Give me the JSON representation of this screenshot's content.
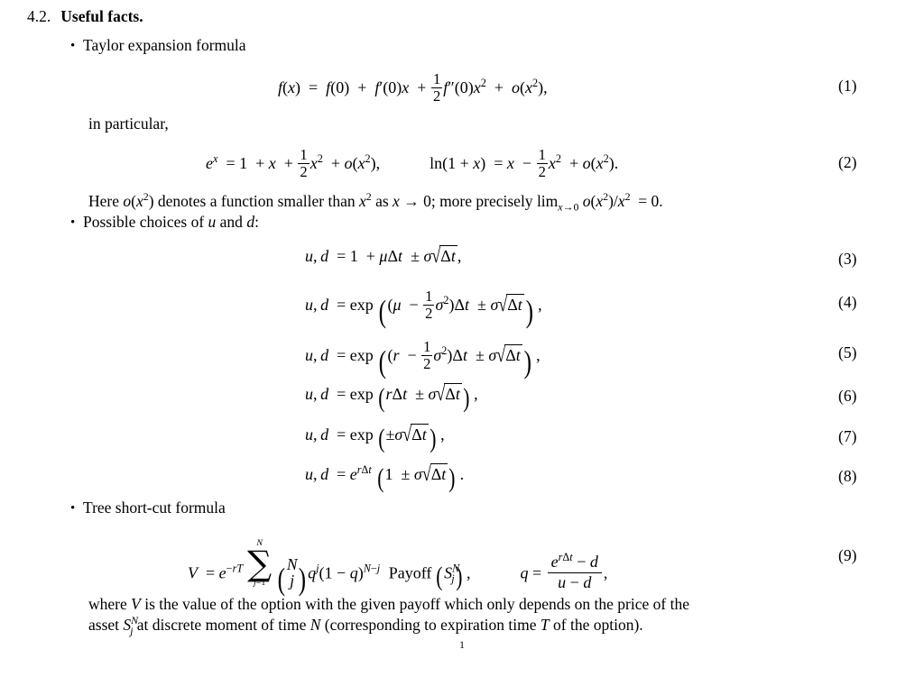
{
  "document": {
    "type": "latex-math-page",
    "page_number": "1",
    "section": {
      "number": "4.2.",
      "title": "Useful facts."
    },
    "bullets": [
      {
        "label": "Taylor expansion formula"
      },
      {
        "label": "Possible choices of u and d:"
      },
      {
        "label": "Tree short-cut formula"
      }
    ],
    "text": {
      "in_particular": "in particular,",
      "here_note": "Here o(x²) denotes a function smaller than x² as x → 0; more precisely limₓ→₀ o(x²)/x² = 0.",
      "closing_line_1": "where V is the value of the option with the given payoff which only depends on the price of the",
      "closing_line_2": "asset Sⱼᴺ at discrete moment of time N (corresponding to expiration time T of the option)."
    },
    "equation_numbers": [
      "(1)",
      "(2)",
      "(3)",
      "(4)",
      "(5)",
      "(6)",
      "(7)",
      "(8)",
      "(9)"
    ],
    "equations": {
      "eq1": "f(x) = f(0) + f'(0)x + (1/2) f''(0)x² + o(x²),",
      "eq2a": "eˣ = 1 + x + (1/2)x² + o(x²),",
      "eq2b": "ln(1 + x) = x − (1/2)x² + o(x²).",
      "eq3": "u, d = 1 + μΔt ± σ√(Δt),",
      "eq4": "u, d = exp((μ − (1/2)σ²)Δt ± σ√(Δt)),",
      "eq5": "u, d = exp((r − (1/2)σ²)Δt ± σ√(Δt)),",
      "eq6": "u, d = exp(rΔt ± σ√(Δt)),",
      "eq7": "u, d = exp(±σ√(Δt)),",
      "eq8": "u, d = e^{rΔt}(1 ± σ√(Δt)).",
      "eq9a": "V = e^{-rT} Σ_{j=1}^{N} (N choose j) qʲ (1−q)^{N−j} Payoff(Sⱼᴺ),",
      "eq9b": "q = (e^{rΔt} − d)/(u − d),"
    },
    "tokens": {
      "payoff_word": "Payoff",
      "exp_word": "exp",
      "ln_word": "ln",
      "lim_word": "lim",
      "here_word": "Here",
      "denotes_phrase": "denotes a function smaller than",
      "as_word": "as",
      "more_precisely": "more precisely",
      "where_word": "where",
      "is_value_phrase": "is the value of the option with the given payoff which only depends on the price of the",
      "asset_word": "asset",
      "discrete_phrase": "at discrete moment of time",
      "corresponding_phrase": "(corresponding to expiration time",
      "of_option_phrase": "of the option)."
    }
  }
}
